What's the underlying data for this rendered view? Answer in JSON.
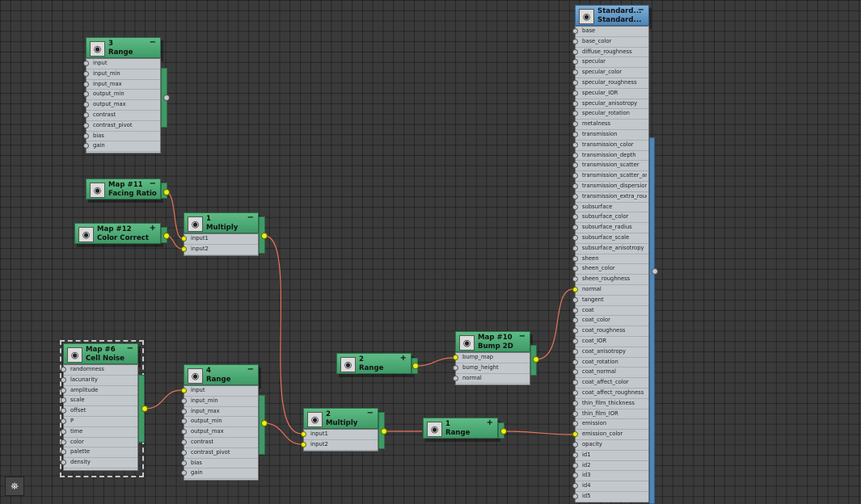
{
  "nodes": {
    "range3": {
      "title1": "3",
      "title2": "Range",
      "control": "−",
      "ports": [
        "input",
        "input_min",
        "input_max",
        "output_min",
        "output_max",
        "contrast",
        "contrast_pivot",
        "bias",
        "gain"
      ]
    },
    "map11": {
      "title1": "Map #11",
      "title2": "Facing Ratio",
      "control": "−"
    },
    "map12": {
      "title1": "Map #12",
      "title2": "Color Correct",
      "control": "+"
    },
    "multiply1": {
      "title1": "1",
      "title2": "Multiply",
      "control": "−",
      "ports": [
        "input1",
        "input2"
      ]
    },
    "map6": {
      "title1": "Map #6",
      "title2": "Cell Noise",
      "control": "−",
      "ports": [
        "randomness",
        "lacunarity",
        "amplitude",
        "scale",
        "offset",
        "P",
        "time",
        "color",
        "palette",
        "density"
      ]
    },
    "range4": {
      "title1": "4",
      "title2": "Range",
      "control": "−",
      "ports": [
        "input",
        "input_min",
        "input_max",
        "output_min",
        "output_max",
        "contrast",
        "contrast_pivot",
        "bias",
        "gain"
      ]
    },
    "range2": {
      "title1": "2",
      "title2": "Range",
      "control": "+"
    },
    "bump": {
      "title1": "Map #10",
      "title2": "Bump 2D",
      "control": "−",
      "ports": [
        "bump_map",
        "bump_height",
        "normal"
      ]
    },
    "multiply2": {
      "title1": "2",
      "title2": "Multiply",
      "control": "−",
      "ports": [
        "input1",
        "input2"
      ]
    },
    "range1": {
      "title1": "1",
      "title2": "Range",
      "control": "+"
    },
    "standard": {
      "title1": "Standard...",
      "title2": "Standard...",
      "control": "−",
      "ports": [
        "base",
        "base_color",
        "diffuse_roughness",
        "specular",
        "specular_color",
        "specular_roughness",
        "specular_IOR",
        "specular_anisotropy",
        "specular_rotation",
        "metalness",
        "transmission",
        "transmission_color",
        "transmission_depth",
        "transmission_scatter",
        "transmission_scatter_ani...",
        "transmission_dispersion*",
        "transmission_extra_roug...",
        "subsurface",
        "subsurface_color",
        "subsurface_radius",
        "subsurface_scale",
        "subsurface_anisotropy",
        "sheen",
        "sheen_color",
        "sheen_roughness",
        "normal",
        "tangent",
        "coat",
        "coat_color",
        "coat_roughness",
        "coat_IOR",
        "coat_anisotropy",
        "coat_rotation",
        "coat_normal",
        "coat_affect_color",
        "coat_affect_roughness",
        "thin_film_thickness",
        "thin_film_IOR",
        "emission",
        "emission_color",
        "opacity",
        "id1",
        "id2",
        "id3",
        "id4",
        "id5"
      ]
    }
  },
  "colors": {
    "wire": "#e8735a",
    "socket_connected": "#e6f212",
    "node_green": "#4fae77",
    "node_blue": "#5b93c4"
  },
  "toolbar": {
    "icon": "binoculars-icon"
  }
}
